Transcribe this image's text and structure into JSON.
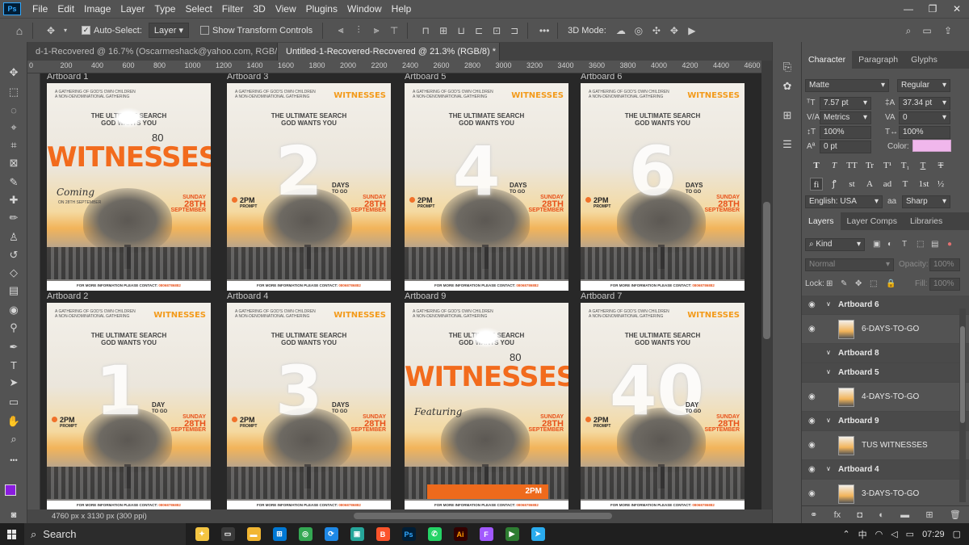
{
  "menubar": {
    "logo": "Ps",
    "items": [
      "File",
      "Edit",
      "Image",
      "Layer",
      "Type",
      "Select",
      "Filter",
      "3D",
      "View",
      "Plugins",
      "Window",
      "Help"
    ],
    "window_controls": {
      "minimize": "—",
      "restore": "❐",
      "close": "✕"
    }
  },
  "options": {
    "auto_select_label": "Auto-Select:",
    "auto_select_checked": true,
    "target": "Layer",
    "transform_label": "Show Transform Controls",
    "mode_label": "3D Mode:",
    "more": "•••"
  },
  "tabs": [
    {
      "label": "d-1-Recovered @ 16.7% (Oscarmeshack@yahoo.com, RGB/8) *",
      "active": false,
      "close": "✕"
    },
    {
      "label": "Untitled-1-Recovered-Recovered @ 21.3% (RGB/8) *",
      "active": true,
      "close": "✕"
    }
  ],
  "ruler": {
    "ticks": [
      "0",
      "200",
      "400",
      "600",
      "800",
      "1000",
      "1200",
      "1400",
      "1600",
      "1800",
      "2000",
      "2200",
      "2400",
      "2600",
      "2800",
      "3000",
      "3200",
      "3400",
      "3600",
      "3800",
      "4000",
      "4200",
      "4400",
      "4600"
    ]
  },
  "artboards": [
    {
      "label": "Artboard 1",
      "kind": "witnesses",
      "coming": "Coming",
      "coming_date": "ON 28TH SEPTEMBER"
    },
    {
      "label": "Artboard 3",
      "kind": "countdown",
      "number": "2",
      "days": "DAYS"
    },
    {
      "label": "Artboard 5",
      "kind": "countdown",
      "number": "4",
      "days": "DAYS"
    },
    {
      "label": "Artboard 6",
      "kind": "countdown",
      "number": "6",
      "days": "DAYS"
    },
    {
      "label": "Artboard 2",
      "kind": "countdown",
      "number": "1",
      "days": "DAY"
    },
    {
      "label": "Artboard 4",
      "kind": "countdown",
      "number": "3",
      "days": "DAYS"
    },
    {
      "label": "Artboard 9",
      "kind": "witnesses",
      "coming": "Featuring",
      "coming_date": ""
    },
    {
      "label": "Artboard 7",
      "kind": "countdown",
      "number": "40",
      "days": "DAY"
    }
  ],
  "poster": {
    "header": "A GATHERING OF GOD'S OWN CHILDREN\nA NON-DENOMINATIONAL GATHERING",
    "witnesses_small": "WITNESSES",
    "title": "THE ULTIMATE SEARCH\nGOD WANTS YOU",
    "eighty": "80",
    "big_title": "WITNESSES",
    "to_go": "TO GO",
    "time": "2PM",
    "time_sub": "PROMPT",
    "day": "SUNDAY",
    "date": "28TH",
    "month": "SEPTEMBER",
    "footer": "FOR MORE INFORMATION PLEASE CONTACT:",
    "phone": "08068786882"
  },
  "status": {
    "text": "4760 px x 3130 px (300 ppi)"
  },
  "character_panel": {
    "tabs": [
      "Character",
      "Paragraph",
      "Glyphs"
    ],
    "font": "Matte",
    "style": "Regular",
    "size": "7.57 pt",
    "leading": "37.34 pt",
    "kerning": "Metrics",
    "tracking": "0",
    "v_scale": "100%",
    "h_scale": "100%",
    "baseline": "0 pt",
    "color_label": "Color:",
    "color": "#f0b7ec",
    "type_buttons": [
      "T",
      "T",
      "TT",
      "Tr",
      "T¹",
      "T₁",
      "T",
      "T"
    ],
    "ot_buttons": [
      "fi",
      "ꝭ",
      "st",
      "A",
      "ad",
      "T",
      "1st",
      "½"
    ],
    "language": "English: USA",
    "antialias_icon": "aa",
    "antialias": "Sharp"
  },
  "layers_panel": {
    "tabs": [
      "Layers",
      "Layer Comps",
      "Libraries"
    ],
    "filter": "Kind",
    "blend": "Normal",
    "opacity_label": "Opacity:",
    "opacity": "100%",
    "lock_label": "Lock:",
    "fill_label": "Fill:",
    "fill": "100%",
    "rows": [
      {
        "type": "group",
        "name": "Artboard 6",
        "visible": true
      },
      {
        "type": "layer",
        "name": "6-DAYS-TO-GO",
        "visible": true
      },
      {
        "type": "group",
        "name": "Artboard 8",
        "visible": false
      },
      {
        "type": "group",
        "name": "Artboard 5",
        "visible": false
      },
      {
        "type": "layer",
        "name": "4-DAYS-TO-GO",
        "visible": true
      },
      {
        "type": "group",
        "name": "Artboard 9",
        "visible": true
      },
      {
        "type": "layer",
        "name": "TUS WITNESSES",
        "visible": true
      },
      {
        "type": "group",
        "name": "Artboard 4",
        "visible": true
      },
      {
        "type": "layer",
        "name": "3-DAYS-TO-GO",
        "visible": true
      }
    ]
  },
  "taskbar": {
    "search": "Search",
    "apps": [
      {
        "name": "widgets",
        "label": "✦",
        "color": "#f4c542"
      },
      {
        "name": "task-view",
        "label": "▭",
        "color": "#3a3a3a"
      },
      {
        "name": "file-explorer",
        "label": "▬",
        "color": "#f2b632"
      },
      {
        "name": "store",
        "label": "⊞",
        "color": "#0078d4"
      },
      {
        "name": "chrome",
        "label": "◎",
        "color": "#34a853"
      },
      {
        "name": "app-blue",
        "label": "⟳",
        "color": "#1e88e5"
      },
      {
        "name": "app-teal",
        "label": "▣",
        "color": "#26a69a"
      },
      {
        "name": "brave",
        "label": "B",
        "color": "#fb542b"
      },
      {
        "name": "photoshop",
        "label": "Ps",
        "color": "#001e36"
      },
      {
        "name": "whatsapp",
        "label": "✆",
        "color": "#25d366"
      },
      {
        "name": "illustrator",
        "label": "Ai",
        "color": "#330000"
      },
      {
        "name": "figma",
        "label": "F",
        "color": "#a259ff"
      },
      {
        "name": "play",
        "label": "▶",
        "color": "#2e7d32"
      },
      {
        "name": "telegram",
        "label": "➤",
        "color": "#2aabee"
      }
    ],
    "time": "07:29"
  }
}
